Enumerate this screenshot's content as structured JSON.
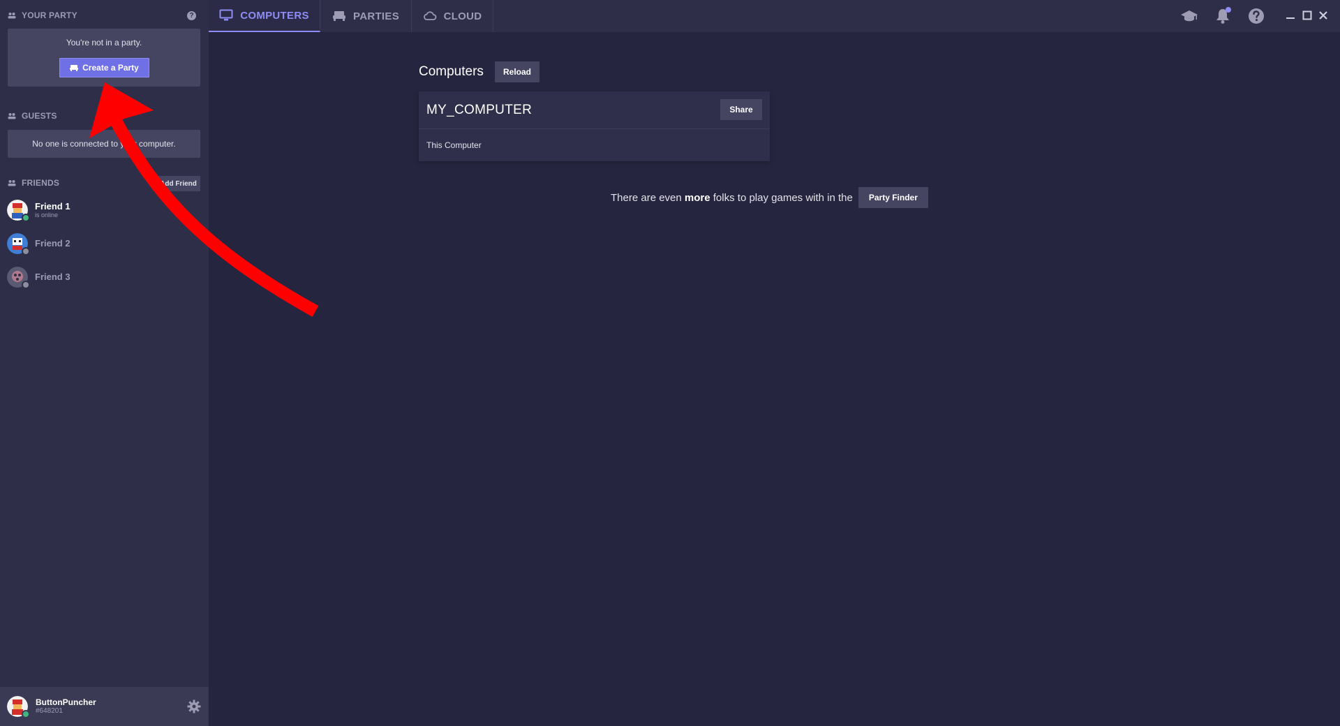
{
  "sidebar": {
    "party_header": "YOUR PARTY",
    "party_help": "?",
    "not_in_party": "You're not in a party.",
    "create_party": "Create a Party",
    "guests_header": "GUESTS",
    "guests_empty": "No one is connected to your computer.",
    "friends_header": "FRIENDS",
    "add_friend": "Add Friend",
    "friends": [
      {
        "name": "Friend 1",
        "status": "is online",
        "online": true
      },
      {
        "name": "Friend 2",
        "status": "",
        "online": false
      },
      {
        "name": "Friend 3",
        "status": "",
        "online": false
      }
    ],
    "user": {
      "name": "ButtonPuncher",
      "tag": "#648201"
    }
  },
  "tabs": [
    {
      "label": "COMPUTERS",
      "icon": "monitor-icon",
      "active": true
    },
    {
      "label": "PARTIES",
      "icon": "sofa-icon",
      "active": false
    },
    {
      "label": "CLOUD",
      "icon": "cloud-icon",
      "active": false
    }
  ],
  "top_icons": [
    "graduation-cap-icon",
    "bell-icon",
    "help-icon"
  ],
  "main": {
    "title": "Computers",
    "reload": "Reload",
    "computer": {
      "name": "MY_COMPUTER",
      "share": "Share",
      "subtitle": "This Computer"
    },
    "finder_pre": "There are even ",
    "finder_bold": "more",
    "finder_post": " folks to play games with in the",
    "party_finder": "Party Finder"
  },
  "colors": {
    "accent": "#8d8df5",
    "primary_button": "#6f6fe6",
    "online": "#43b581",
    "offline": "#8e8e9e",
    "annotation_arrow": "#ff0000"
  }
}
